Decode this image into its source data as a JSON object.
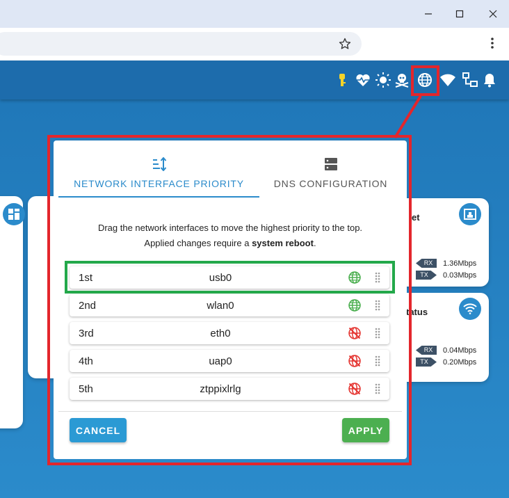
{
  "browser": {
    "minimize_icon": "minimize-icon",
    "maximize_icon": "maximize-icon",
    "close_icon": "close-icon",
    "bookmark_icon": "star-icon",
    "menu_icon": "kebab-menu-icon"
  },
  "header": {
    "icons": [
      "usb-key-icon",
      "heart-pulse-icon",
      "sun-icon",
      "skull-crossbones-icon",
      "globe-icon",
      "wifi-icon",
      "lan-icon",
      "bell-icon"
    ]
  },
  "cards": {
    "ethernet": {
      "title": "et",
      "rx_tag": "RX",
      "tx_tag": "TX",
      "rx": "1.36Mbps",
      "tx": "0.03Mbps"
    },
    "wifi": {
      "title": "tatus",
      "rx_tag": "RX",
      "tx_tag": "TX",
      "rx": "0.04Mbps",
      "tx": "0.20Mbps"
    }
  },
  "dialog": {
    "tabs": [
      {
        "label": "NETWORK INTERFACE PRIORITY",
        "icon": "sort-priority-icon",
        "active": true
      },
      {
        "label": "DNS CONFIGURATION",
        "icon": "dns-server-icon",
        "active": false
      }
    ],
    "description_line1": "Drag the network interfaces to move the highest priority to the top.",
    "description_line2_prefix": "Applied changes require a ",
    "description_line2_bold": "system reboot",
    "description_line2_suffix": ".",
    "interfaces": [
      {
        "rank": "1st",
        "name": "usb0",
        "connected": true
      },
      {
        "rank": "2nd",
        "name": "wlan0",
        "connected": true
      },
      {
        "rank": "3rd",
        "name": "eth0",
        "connected": false
      },
      {
        "rank": "4th",
        "name": "uap0",
        "connected": false
      },
      {
        "rank": "5th",
        "name": "ztppixlrlg",
        "connected": false
      }
    ],
    "cancel_label": "CANCEL",
    "apply_label": "APPLY"
  },
  "colors": {
    "accent": "#2b8bcb",
    "header": "#1d6cac",
    "connected": "#4caf50",
    "disconnected": "#e53935",
    "annotation_red": "#e3262c",
    "annotation_green": "#23a84a"
  }
}
